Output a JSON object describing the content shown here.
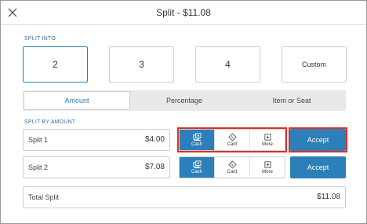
{
  "header": {
    "title": "Split - $11.08",
    "close_icon": "close-icon"
  },
  "split_into": {
    "label": "SPLIT INTO",
    "options": [
      "2",
      "3",
      "4",
      "Custom"
    ],
    "selected": "2"
  },
  "tabs": {
    "items": [
      "Amount",
      "Percentage",
      "Item or Seat"
    ],
    "active": "Amount"
  },
  "split_by": {
    "label": "SPLIT BY AMOUNT",
    "rows": [
      {
        "label": "Split 1",
        "amount": "$4.00",
        "methods": [
          {
            "label": "Cash",
            "icon": "cash-icon",
            "active": true
          },
          {
            "label": "Card",
            "icon": "card-icon",
            "active": false
          },
          {
            "label": "More",
            "icon": "more-icon",
            "active": false
          }
        ],
        "accept_label": "Accept"
      },
      {
        "label": "Split 2",
        "amount": "$7.08",
        "methods": [
          {
            "label": "Cash",
            "icon": "cash-icon",
            "active": true
          },
          {
            "label": "Card",
            "icon": "card-icon",
            "active": false
          },
          {
            "label": "More",
            "icon": "more-icon",
            "active": false
          }
        ],
        "accept_label": "Accept"
      }
    ]
  },
  "total": {
    "label": "Total Split",
    "amount": "$11.08"
  },
  "colors": {
    "accent": "#2c7fb8",
    "highlight": "#d9302c",
    "section_label": "#3c6fa1"
  }
}
